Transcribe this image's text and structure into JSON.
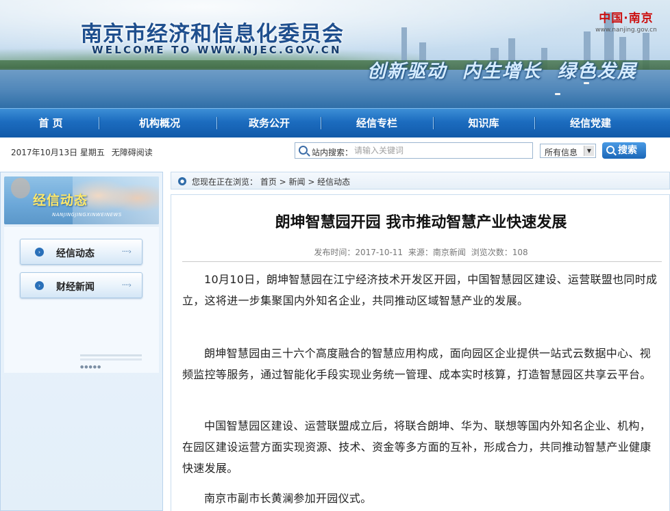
{
  "header": {
    "title": "南京市经济和信息化委员会",
    "subtitle": "WELCOME TO WWW.NJEC.GOV.CN",
    "slogan": "创新驱动  内生增长  绿色发展",
    "logo_main": "中国·南京",
    "logo_url": "www.nanjing.gov.cn"
  },
  "nav": {
    "items": [
      "首 页",
      "机构概况",
      "政务公开",
      "经信专栏",
      "知识库",
      "经信党建"
    ]
  },
  "infobar": {
    "date": "2017年10月13日 星期五",
    "accessibility": "无障碍阅读"
  },
  "search": {
    "label": "站内搜索：",
    "placeholder": "请输入关键词",
    "scope_value": "所有信息",
    "button_label": "搜索"
  },
  "sidebar": {
    "banner_title": "经信动态",
    "banner_sub": "NANJINGJINGXINWEINEWS",
    "items": [
      {
        "label": "经信动态",
        "dots": "····›"
      },
      {
        "label": "财经新闻",
        "dots": "····›"
      }
    ]
  },
  "breadcrumb": {
    "text": "您现在正在浏览： 首页 > 新闻 > 经信动态"
  },
  "article": {
    "title": "朗坤智慧园开园 我市推动智慧产业快速发展",
    "published_label": "发布时间：",
    "published": "2017-10-11",
    "source_label": "来源：",
    "source": "南京新闻",
    "views_label": "浏览次数：",
    "views": "108",
    "paragraphs": [
      "10月10日，朗坤智慧园在江宁经济技术开发区开园，中国智慧园区建设、运营联盟也同时成立，这将进一步集聚国内外知名企业，共同推动区域智慧产业的发展。",
      "朗坤智慧园由三十六个高度融合的智慧应用构成，面向园区企业提供一站式云数据中心、视频监控等服务，通过智能化手段实现业务统一管理、成本实时核算，打造智慧园区共享云平台。",
      "中国智慧园区建设、运营联盟成立后，将联合朗坤、华为、联想等国内外知名企业、机构，在园区建设运营方面实现资源、技术、资金等多方面的互补，形成合力，共同推动智慧产业健康快速发展。",
      "南京市副市长黄澜参加开园仪式。"
    ]
  },
  "colors": {
    "nav_blue": "#1c6cbf",
    "title_blue": "#1f4f8e",
    "sidebar_bg": "#e3eff9"
  }
}
